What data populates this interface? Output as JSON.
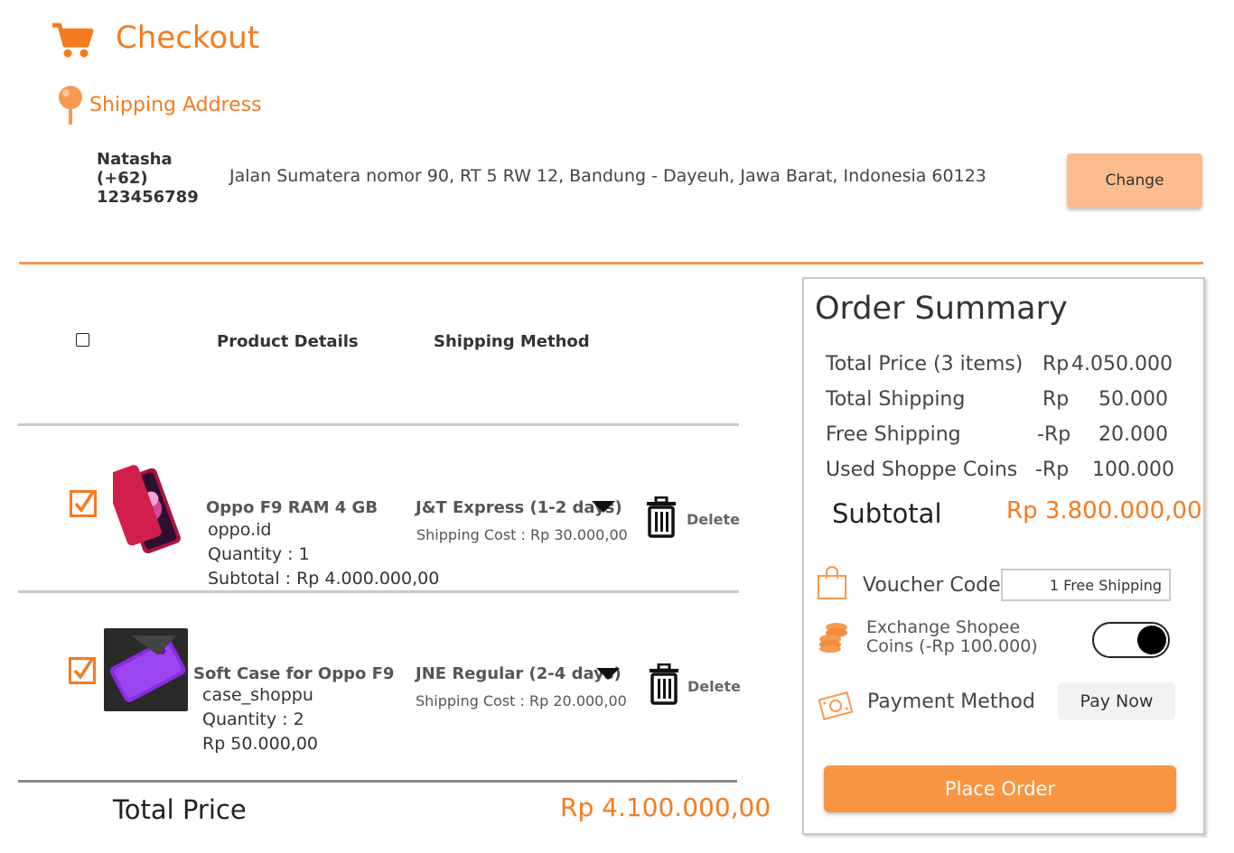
{
  "header": {
    "title": "Checkout",
    "cart_icon": "shopping-cart-icon"
  },
  "shipping_address": {
    "title": "Shipping Address",
    "pin_icon": "map-pin-icon",
    "name": "Natasha",
    "phone_code": "(+62)",
    "phone": "123456789",
    "address": "Jalan Sumatera nomor 90, RT 5 RW 12, Bandung - Dayeuh, Jawa Barat, Indonesia 60123",
    "change_label": "Change"
  },
  "table": {
    "headers": {
      "product": "Product Details",
      "shipping": "Shipping Method"
    },
    "items": [
      {
        "name": "Oppo F9 RAM 4 GB",
        "seller": "oppo.id",
        "quantity": "Quantity : 1",
        "subtotal": "Subtotal : Rp 4.000.000,00",
        "shipping_method": "J&T Express (1-2 days)",
        "shipping_cost": "Shipping Cost : Rp 30.000,00",
        "delete_label": "Delete",
        "checked": true
      },
      {
        "name": "Soft Case for Oppo F9",
        "seller": "case_shoppu",
        "quantity": "Quantity : 2",
        "subtotal": "Rp 50.000,00",
        "shipping_method": "JNE Regular (2-4 days)",
        "shipping_cost": "Shipping Cost : Rp 20.000,00",
        "delete_label": "Delete",
        "checked": true
      }
    ],
    "total_label": "Total Price",
    "total_value": "Rp 4.100.000,00"
  },
  "summary": {
    "title": "Order Summary",
    "rows": [
      {
        "label": "Total Price (3 items)",
        "currency": "Rp",
        "value": "4.050.000"
      },
      {
        "label": "Total Shipping",
        "currency": "Rp",
        "value": "50.000"
      },
      {
        "label": "Free Shipping",
        "currency": "-Rp",
        "value": "20.000"
      },
      {
        "label": "Used Shoppe Coins",
        "currency": "-Rp",
        "value": "100.000"
      }
    ],
    "subtotal_label": "Subtotal",
    "subtotal_value": "Rp 3.800.000,00",
    "voucher_label": "Voucher Code",
    "voucher_value": "1 Free Shipping",
    "coins_label_line1": "Exchange Shopee",
    "coins_label_line2": "Coins (-Rp 100.000)",
    "coins_toggle_on": true,
    "payment_label": "Payment Method",
    "payment_value": "Pay Now",
    "place_order_label": "Place Order"
  },
  "colors": {
    "accent": "#f47b20",
    "button_light": "#fbbd8e",
    "place_order": "#f99540"
  }
}
